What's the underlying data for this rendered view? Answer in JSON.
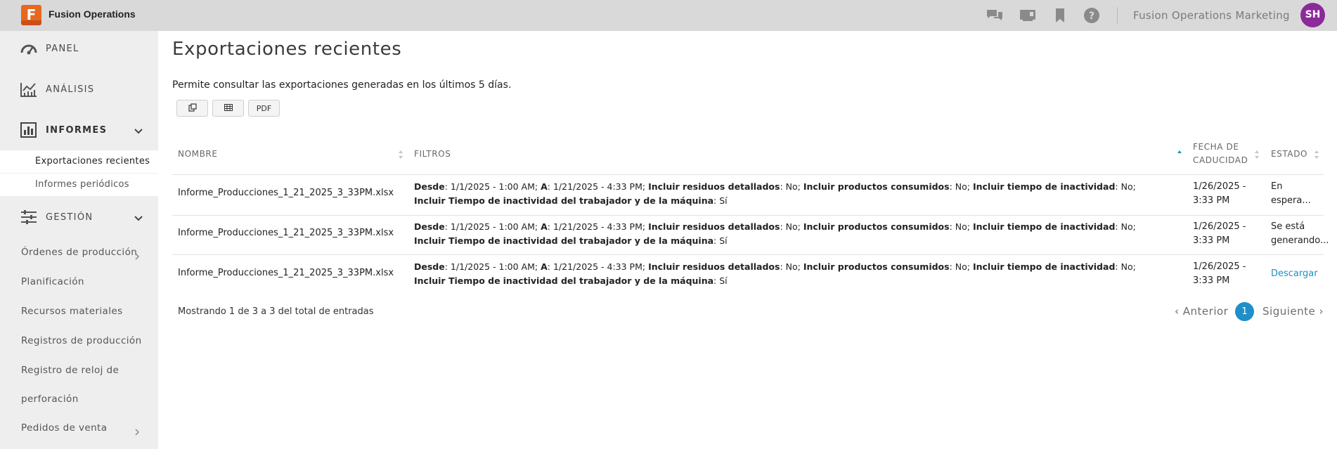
{
  "app": {
    "logo_letter": "F",
    "name": "Fusion Operations",
    "org_name": "Fusion Operations Marketing",
    "avatar_initials": "SH",
    "accent": "#1e8fc9",
    "logo_color": "#e8681f",
    "avatar_color": "#8c2a9a",
    "top_icons": [
      "chat-icon",
      "presentation-icon",
      "bookmark-icon",
      "help-icon"
    ]
  },
  "sidebar": {
    "main_items": [
      {
        "label": "PANEL",
        "icon": "gauge-icon"
      },
      {
        "label": "ANÁLISIS",
        "icon": "analytics-icon"
      },
      {
        "label": "INFORMES",
        "icon": "report-chart-icon"
      },
      {
        "label": "GESTIÓN",
        "icon": "sliders-icon"
      }
    ],
    "informes_subitems": [
      "Exportaciones recientes",
      "Informes periódicos"
    ],
    "gestion_subitems": [
      "Órdenes de producción",
      "Planificación",
      "Recursos materiales",
      "Registros de producción",
      "Registro de reloj de",
      "perforación",
      "Pedidos de venta"
    ]
  },
  "main": {
    "title": "Exportaciones recientes",
    "description": "Permite consultar las exportaciones generadas en los últimos 5 días.",
    "toolbar": {
      "copy_icon": "copy-icon",
      "table_icon": "table-icon",
      "pdf_label": "PDF"
    },
    "table": {
      "headers": {
        "name": "NOMBRE",
        "filters": "FILTROS",
        "expiry_line1": "FECHA DE",
        "expiry_line2": "CADUCIDAD",
        "state": "ESTADO"
      },
      "filter_labels": {
        "desde": "Desde",
        "a": "A",
        "residuos": "Incluir residuos detallados",
        "productos": "Incluir productos consumidos",
        "inactividad": "Incluir tiempo de inactividad",
        "tiempo_line1": "Incluir Tiempo de",
        "tiempo_line2": "inactividad del trabajador y de la máquina"
      },
      "rows": [
        {
          "name": "Informe_Producciones_1_21_2025_3_33PM.xlsx",
          "desde": ": 1/1/2025 - 1:00 AM; ",
          "a": ": 1/21/2025 - 4:33 PM; ",
          "residuos": ": No; ",
          "productos": ": No; ",
          "inactividad": ": No; ",
          "tiempo": ": Sí",
          "date_line1": "1/26/2025 -",
          "date_line2": "3:33 PM",
          "state_line1": "En",
          "state_line2": "espera..."
        },
        {
          "name": "Informe_Producciones_1_21_2025_3_33PM.xlsx",
          "desde": ": 1/1/2025 - 1:00 AM; ",
          "a": ": 1/21/2025 - 4:33 PM; ",
          "residuos": ": No; ",
          "productos": ": No; ",
          "inactividad": ": No; ",
          "tiempo": ": Sí",
          "date_line1": "1/26/2025 -",
          "date_line2": "3:33 PM",
          "state_line1": "Se está",
          "state_line2": "generando..."
        },
        {
          "name": "Informe_Producciones_1_21_2025_3_33PM.xlsx",
          "desde": ": 1/1/2025 - 1:00 AM; ",
          "a": ": 1/21/2025 - 4:33 PM; ",
          "residuos": ": No; ",
          "productos": ": No; ",
          "inactividad": ": No; ",
          "tiempo": ": Sí",
          "date_line1": "1/26/2025 -",
          "date_line2": "3:33 PM",
          "state_link": "Descargar"
        }
      ]
    },
    "footer": {
      "info": "Mostrando 1 de 3 a 3 del total de entradas",
      "prev": "Anterior",
      "page": "1",
      "next": "Siguiente"
    }
  }
}
